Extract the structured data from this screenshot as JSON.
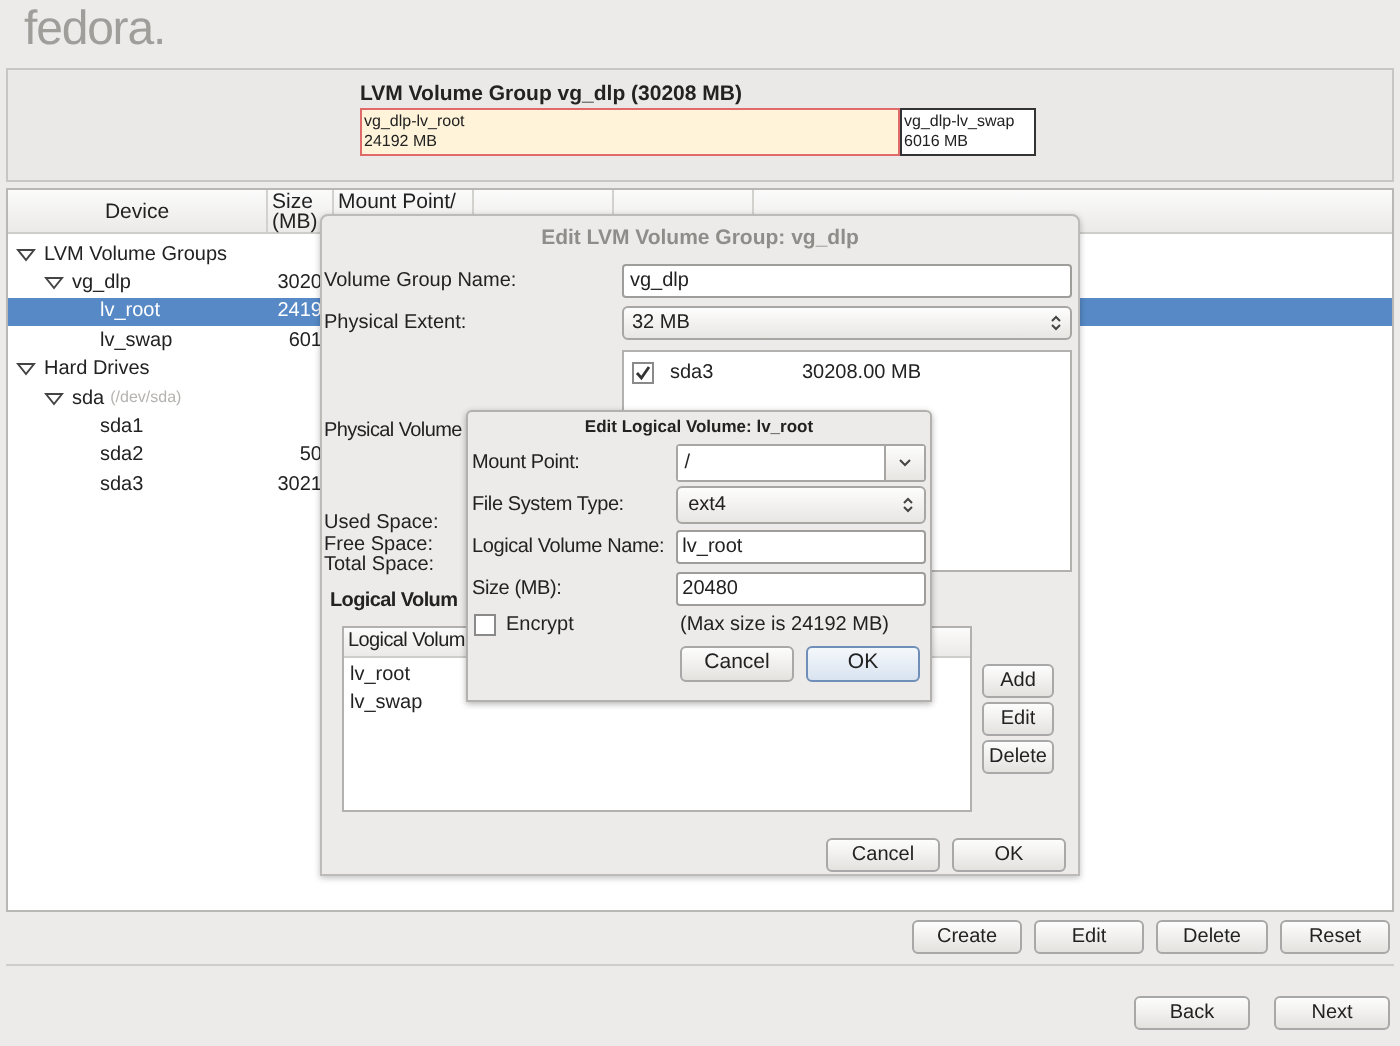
{
  "logo": "fedora.",
  "volume_map": {
    "title": "LVM Volume Group vg_dlp (30208 MB)",
    "segments": [
      {
        "name": "vg_dlp-lv_root",
        "size": "24192 MB",
        "selected": true
      },
      {
        "name": "vg_dlp-lv_swap",
        "size": "6016 MB",
        "selected": false
      }
    ]
  },
  "device_table": {
    "columns": [
      "Device",
      "Size (MB)",
      "Mount Point/"
    ],
    "rows": [
      {
        "device": "LVM Volume Groups",
        "expanded": true,
        "selected": false,
        "children": [
          {
            "device": "vg_dlp",
            "size": "3020",
            "expanded": true,
            "selected": false,
            "children": [
              {
                "device": "lv_root",
                "size": "2419",
                "selected": true
              },
              {
                "device": "lv_swap",
                "size": "601",
                "selected": false
              }
            ]
          }
        ]
      },
      {
        "device": "Hard Drives",
        "expanded": true,
        "selected": false,
        "children": [
          {
            "device": "sda",
            "path": "(/dev/sda)",
            "expanded": true,
            "selected": false,
            "children": [
              {
                "device": "sda1",
                "selected": false
              },
              {
                "device": "sda2",
                "size": "50",
                "selected": false
              },
              {
                "device": "sda3",
                "size": "3021",
                "selected": false
              }
            ]
          }
        ]
      }
    ]
  },
  "vg_dialog": {
    "title": "Edit LVM Volume Group: vg_dlp",
    "active": false,
    "volume_group_name": {
      "label": "Volume Group Name:",
      "value": "vg_dlp"
    },
    "physical_extent": {
      "label": "Physical Extent:",
      "value": "32 MB"
    },
    "physical_volumes": {
      "label": "Physical Volume",
      "items": [
        {
          "name": "sda3",
          "size": "30208.00 MB",
          "checked": true
        }
      ]
    },
    "space_labels": [
      "Used Space:",
      "Free Space:",
      "Total Space:"
    ],
    "logical_volumes": {
      "title": "Logical Volum",
      "column": "Logical Volum",
      "rows": [
        "lv_root",
        "lv_swap"
      ],
      "buttons": [
        "Add",
        "Edit",
        "Delete"
      ]
    },
    "buttons": [
      "Cancel",
      "OK"
    ]
  },
  "lv_dialog": {
    "title": "Edit Logical Volume: lv_root",
    "active": true,
    "mount_point": {
      "label": "Mount Point:",
      "value": "/"
    },
    "file_system_type": {
      "label": "File System Type:",
      "value": "ext4"
    },
    "logical_volume_name": {
      "label": "Logical Volume Name:",
      "value": "lv_root"
    },
    "size": {
      "label": "Size (MB):",
      "value": "20480"
    },
    "encrypt": {
      "label": "Encrypt",
      "checked": false
    },
    "max_size": "(Max size is 24192 MB)",
    "buttons": [
      {
        "label": "Cancel",
        "default": false
      },
      {
        "label": "OK",
        "default": true
      }
    ]
  },
  "actions": [
    "Create",
    "Edit",
    "Delete",
    "Reset"
  ],
  "navigation": [
    "Back",
    "Next"
  ]
}
